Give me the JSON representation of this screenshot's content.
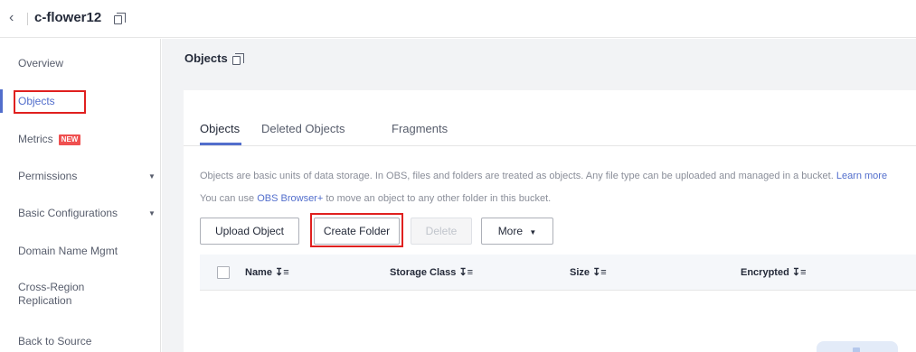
{
  "header": {
    "back_icon": "chevron-left-icon",
    "bucket_name": "c-flower12",
    "copy_icon": "copy-icon"
  },
  "sidebar": {
    "items": [
      {
        "label": "Overview"
      },
      {
        "label": "Objects",
        "active": true
      },
      {
        "label": "Metrics",
        "badge": "NEW"
      },
      {
        "label": "Permissions",
        "expandable": true
      },
      {
        "label": "Basic Configurations",
        "expandable": true
      },
      {
        "label": "Domain Name Mgmt"
      },
      {
        "label": "Cross-Region Replication"
      },
      {
        "label": "Back to Source"
      }
    ]
  },
  "main": {
    "title": "Objects",
    "tabs": [
      {
        "label": "Objects",
        "active": true
      },
      {
        "label": "Deleted Objects"
      },
      {
        "label": "Fragments"
      }
    ],
    "info_line1": "Objects are basic units of data storage. In OBS, files and folders are treated as objects. Any file type can be uploaded and managed in a bucket.",
    "info_line1_link": "Learn more",
    "info_line2_prefix": "You can use",
    "info_line2_link": "OBS Browser+",
    "info_line2_suffix": "to move an object to any other folder in this bucket.",
    "buttons": {
      "upload": "Upload Object",
      "create_folder": "Create Folder",
      "delete": "Delete",
      "more": "More"
    },
    "table": {
      "columns": [
        "Name",
        "Storage Class",
        "Size",
        "Encrypted"
      ],
      "sort_icon": "sort-icon"
    }
  },
  "colors": {
    "accent": "#526ecc",
    "highlight": "#e0201f",
    "badge": "#ef5050"
  }
}
